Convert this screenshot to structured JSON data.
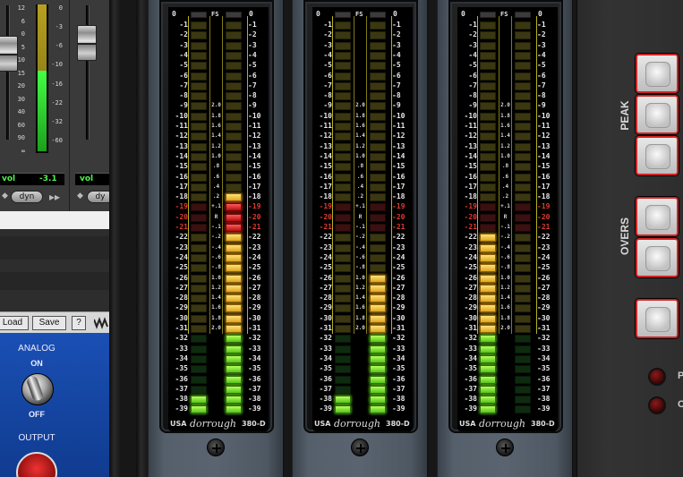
{
  "mixer": {
    "left_scale": [
      "12",
      "6",
      "0",
      "5",
      "10",
      "15",
      "20",
      "30",
      "40",
      "60",
      "90",
      "∞"
    ],
    "right_scale": [
      "0",
      "-3",
      "-6",
      "-10",
      "-16",
      "-22",
      "-32",
      "-60"
    ],
    "strip1": {
      "vol_label": "vol",
      "vol_value": "-3.1",
      "dyn_label": "dyn",
      "meter_level": 0.55
    },
    "strip2": {
      "vol_label": "vol",
      "dyn_label": "dy"
    }
  },
  "plugin": {
    "load_label": "Load",
    "save_label": "Save",
    "help_label": "?",
    "analog_label": "ANALOG",
    "on_label": "ON",
    "off_label": "OFF",
    "output_label": "OUTPUT"
  },
  "meter_scale": {
    "top_left": "0",
    "top_center": "FS",
    "top_right": "0",
    "db_labels": [
      "-1",
      "-2",
      "-3",
      "-4",
      "-5",
      "-6",
      "-7",
      "-8",
      "-9",
      "-10",
      "-11",
      "-12",
      "-13",
      "-14",
      "-15",
      "-16",
      "-17",
      "-18",
      "-19",
      "-20",
      "-21",
      "-22",
      "-23",
      "-24",
      "-25",
      "-26",
      "-27",
      "-28",
      "-29",
      "-30",
      "-31",
      "-32",
      "-33",
      "-34",
      "-35",
      "-36",
      "-37",
      "-38",
      "-39"
    ],
    "center_labels": [
      "",
      "",
      "",
      "",
      "",
      "",
      "",
      "",
      "2.0",
      "1.8",
      "1.6",
      "1.4",
      "1.2",
      "1.0",
      ".8",
      ".6",
      ".4",
      ".2",
      "+.1",
      "R",
      "-.1",
      "-.2",
      "-.4",
      "-.6",
      "-.8",
      "1.0",
      "1.2",
      "1.4",
      "1.6",
      "1.8",
      "2.0",
      "",
      "",
      "",
      "",
      "",
      "",
      "",
      ""
    ]
  },
  "meters": [
    {
      "brand_usa": "USA",
      "brand_logo": "dorrough",
      "brand_model": "380-D",
      "left_lit_from": 38,
      "left_lit_to": 39,
      "right_lit_from": 18,
      "right_lit_to": 39
    },
    {
      "brand_usa": "USA",
      "brand_logo": "dorrough",
      "brand_model": "380-D",
      "left_lit_from": 38,
      "left_lit_to": 39,
      "right_lit_from": 26,
      "right_lit_to": 39
    },
    {
      "brand_usa": "USA",
      "brand_logo": "dorrough",
      "brand_model": "380-D",
      "left_lit_from": 22,
      "left_lit_to": 39,
      "right_lit_from": 0,
      "right_lit_to": 0
    }
  ],
  "controls": {
    "peak_label": "PEAK",
    "overs_label": "OVERS",
    "led1_label": "P",
    "led2_label": "C"
  },
  "colors": {
    "segment_yellow": "#e0a51c",
    "segment_red": "#d41616",
    "segment_green": "#6fd31e",
    "button_border_red": "#d12424",
    "panel_blue": "#1a4fb4"
  }
}
